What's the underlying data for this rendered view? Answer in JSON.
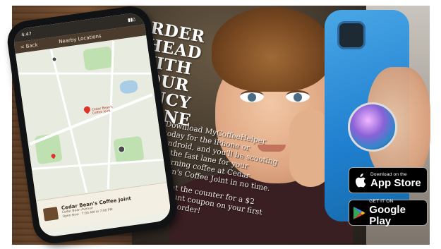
{
  "headline": {
    "lines": [
      "ORDER",
      "AHEAD",
      "WITH",
      "YOUR",
      "FANCY",
      "PHONE"
    ]
  },
  "body": {
    "paragraph1": "Download MyCoffeeHelper today for the iPhone or Android, and you'll be scooting in the fast lane for your morning coffee at Cedar Bean's Coffee Joint in no time.",
    "paragraph2": "Ask at the counter for a $2 discount coupon on your first online order!"
  },
  "phone": {
    "status_time": "4:47",
    "back_label": "< Back",
    "nav_title": "Nearby Locations",
    "pin_label": "Cedar Bean's Coffee Joint",
    "listing_name": "Cedar Bean's Coffee Joint",
    "listing_address": "Cedar Bean Avenue",
    "listing_hours": "Open Now · 7:00 AM to 7:00 PM"
  },
  "badges": {
    "apple_small": "Download on the",
    "apple_big": "App Store",
    "google_small": "GET IT ON",
    "google_big": "Google Play"
  },
  "colors": {
    "wood": "#6e4a2c",
    "phone_nav": "#4b3b2c",
    "pin": "#e0322b",
    "badge_bg": "#000000",
    "blue_phone": "#1f7fcf"
  }
}
